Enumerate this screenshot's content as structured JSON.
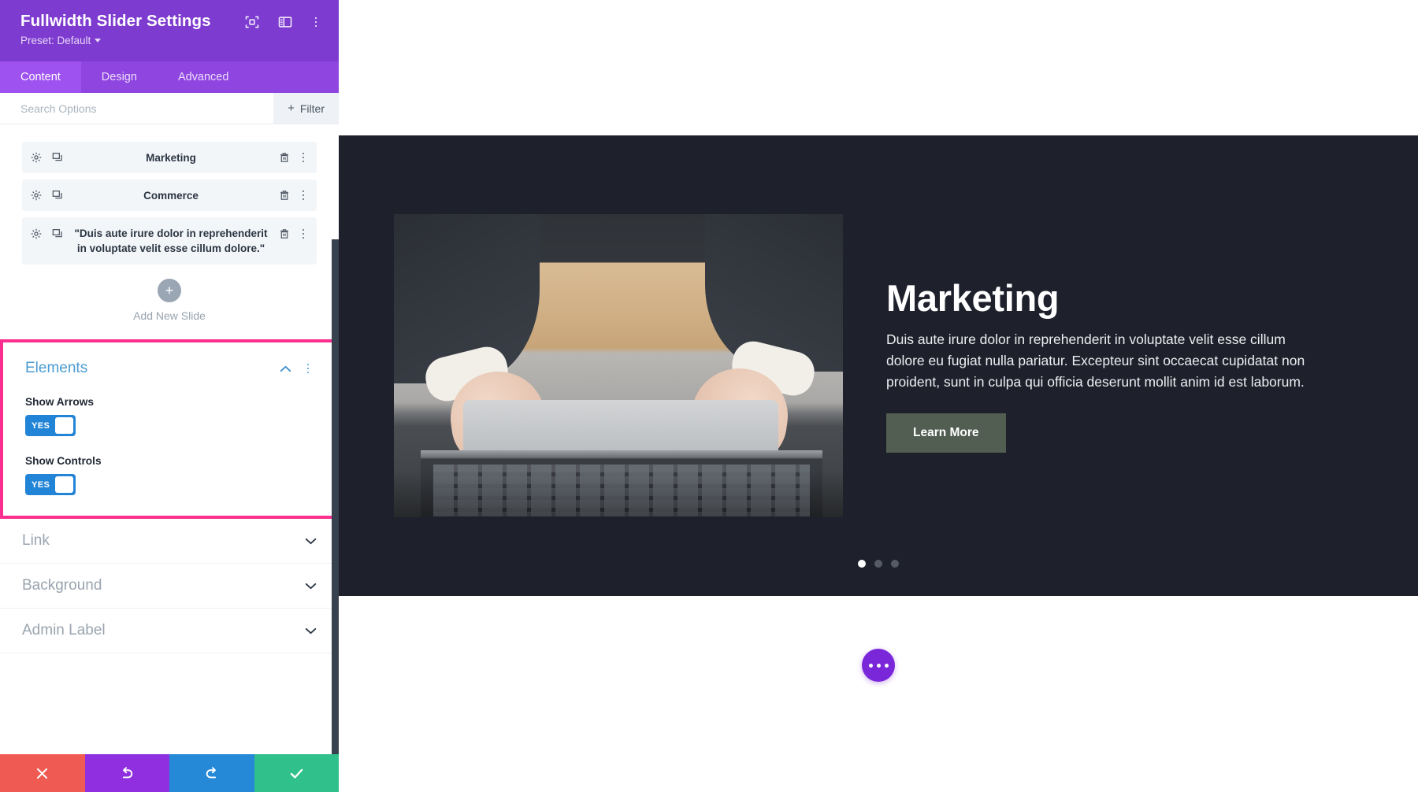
{
  "panel": {
    "title": "Fullwidth Slider Settings",
    "preset_label": "Preset: Default",
    "header_icons": [
      {
        "name": "focus-icon"
      },
      {
        "name": "layout-panel-icon"
      },
      {
        "name": "more-vertical-icon"
      }
    ],
    "tabs": [
      {
        "label": "Content",
        "active": true
      },
      {
        "label": "Design",
        "active": false
      },
      {
        "label": "Advanced",
        "active": false
      }
    ],
    "search": {
      "placeholder": "Search Options",
      "value": "",
      "filter_label": "Filter",
      "filter_plus": "+"
    },
    "slides": [
      {
        "label": "Marketing"
      },
      {
        "label": "Commerce"
      },
      {
        "label": "\"Duis aute irure dolor in reprehenderit in voluptate velit esse cillum dolore.\""
      }
    ],
    "add_slide": {
      "plus": "+",
      "label": "Add New Slide"
    },
    "elements_section": {
      "title": "Elements",
      "highlight_color": "#fa2f8f",
      "fields": [
        {
          "label": "Show Arrows",
          "toggle_value": "YES"
        },
        {
          "label": "Show Controls",
          "toggle_value": "YES"
        }
      ]
    },
    "collapsed_sections": [
      {
        "label": "Link"
      },
      {
        "label": "Background"
      },
      {
        "label": "Admin Label"
      }
    ],
    "actions": [
      {
        "name": "cancel",
        "icon": "close-icon",
        "color": "#ef5a53"
      },
      {
        "name": "undo",
        "icon": "undo-icon",
        "color": "#8f2fe0"
      },
      {
        "name": "redo",
        "icon": "redo-icon",
        "color": "#2689d8"
      },
      {
        "name": "save",
        "icon": "check-icon",
        "color": "#2fc08b"
      }
    ]
  },
  "preview": {
    "slide": {
      "title": "Marketing",
      "description": "Duis aute irure dolor in reprehenderit in voluptate velit esse cillum dolore eu fugiat nulla pariatur. Excepteur sint occaecat cupidatat non proident, sunt in culpa qui officia deserunt mollit anim id est laborum.",
      "button_label": "Learn More",
      "background_color": "#1e212c"
    },
    "pagination": {
      "total": 3,
      "active_index": 0
    },
    "fab": {
      "name": "more-options-fab"
    }
  }
}
